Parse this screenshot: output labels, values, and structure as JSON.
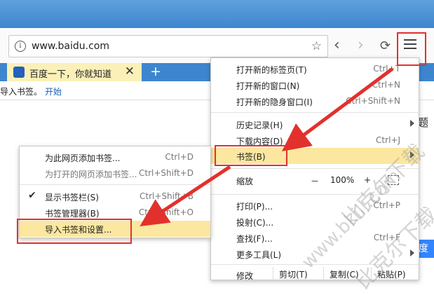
{
  "browser": {
    "url": "www.baidu.com",
    "tab": {
      "title": "百度一下，你就知道"
    }
  },
  "bookmarks_bar": {
    "text": "导入书签。",
    "link": "开始"
  },
  "page_fragments": {
    "right_text": "题",
    "button_text": "度一"
  },
  "main_menu": {
    "items": [
      {
        "label": "打开新的标签页(T)",
        "shortcut": "Ctrl+T"
      },
      {
        "label": "打开新的窗口(N)",
        "shortcut": "Ctrl+N"
      },
      {
        "label": "打开新的隐身窗口(I)",
        "shortcut": "Ctrl+Shift+N"
      },
      {
        "label": "历史记录(H)",
        "shortcut": ""
      },
      {
        "label": "下载内容(D)",
        "shortcut": "Ctrl+J"
      },
      {
        "label": "书签(B)",
        "shortcut": ""
      },
      {
        "label": "缩放",
        "shortcut": ""
      },
      {
        "label": "打印(P)...",
        "shortcut": "Ctrl+P"
      },
      {
        "label": "投射(C)...",
        "shortcut": ""
      },
      {
        "label": "查找(F)...",
        "shortcut": "Ctrl+F"
      },
      {
        "label": "更多工具(L)",
        "shortcut": ""
      },
      {
        "label": "修改",
        "shortcut": ""
      }
    ],
    "zoom": {
      "minus": "－",
      "value": "100%",
      "plus": "+"
    },
    "edit": {
      "cut": "剪切(T)",
      "copy": "复制(C)",
      "paste": "粘贴(P)"
    }
  },
  "bookmarks_submenu": {
    "items": [
      {
        "label": "为此网页添加书签...",
        "shortcut": "Ctrl+D"
      },
      {
        "label": "为打开的网页添加书签...",
        "shortcut": "Ctrl+Shift+D"
      },
      {
        "label": "显示书签栏(S)",
        "shortcut": "Ctrl+Shift+B"
      },
      {
        "label": "书签管理器(B)",
        "shortcut": "Ctrl+Shift+O"
      },
      {
        "label": "导入书签和设置...",
        "shortcut": ""
      }
    ],
    "checkmark": "✔"
  },
  "watermark": [
    "比克尔下载",
    "www.bkill.com",
    "比克尔下载"
  ],
  "colors": {
    "highlight": "#fbe7a0",
    "annotation": "#e2312c",
    "tab": "#fbf0b8",
    "frame": "#3d86cf"
  }
}
